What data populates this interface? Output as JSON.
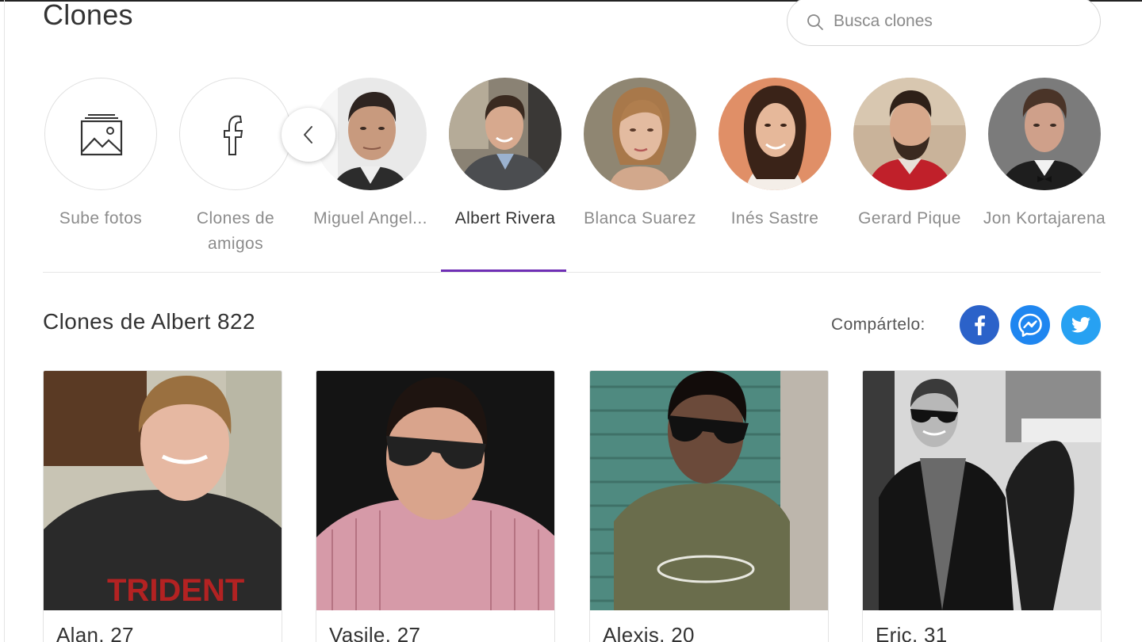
{
  "header": {
    "title": "Clones",
    "search_placeholder": "Busca clones"
  },
  "strip": {
    "items": [
      {
        "label": "Sube fotos",
        "icon": "image-icon"
      },
      {
        "label": "Clones de amigos",
        "icon": "facebook-icon"
      },
      {
        "label": "Miguel Angel..."
      },
      {
        "label": "Albert Rivera",
        "active": true
      },
      {
        "label": "Blanca Suarez"
      },
      {
        "label": "Inés Sastre"
      },
      {
        "label": "Gerard Pique"
      },
      {
        "label": "Jon Kortajarena"
      }
    ]
  },
  "section": {
    "title": "Clones de Albert 822",
    "share_label": "Compártelo:"
  },
  "colors": {
    "accent": "#6f2fb5",
    "facebook": "#2b62c9",
    "messenger": "#1f86f0",
    "twitter": "#27a1f2"
  },
  "cards": [
    {
      "name": "Alan, 27"
    },
    {
      "name": "Vasile, 27"
    },
    {
      "name": "Alexis, 20"
    },
    {
      "name": "Eric, 31"
    }
  ]
}
